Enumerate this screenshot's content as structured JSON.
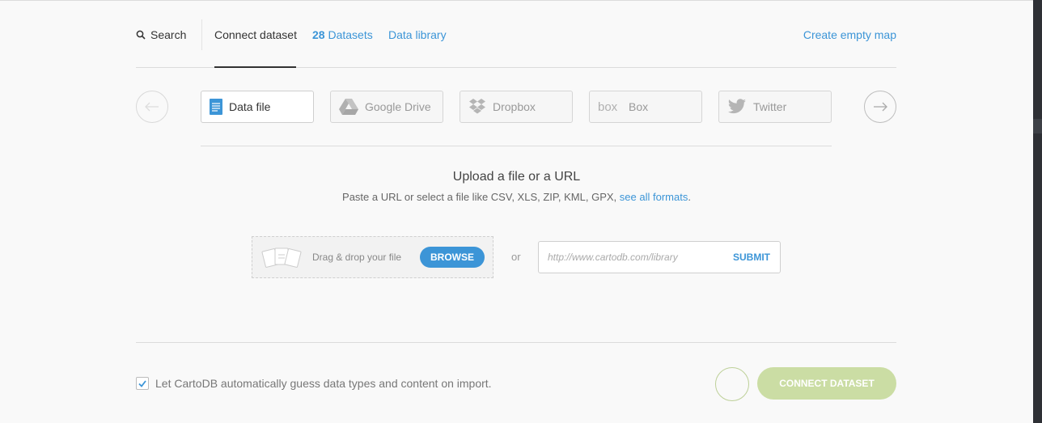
{
  "tabs": {
    "search": "Search",
    "connect": "Connect dataset",
    "datasets_count": "28",
    "datasets_label": "Datasets",
    "library": "Data library",
    "create": "Create empty map"
  },
  "sources": [
    {
      "label": "Data file",
      "icon": "file-icon"
    },
    {
      "label": "Google Drive",
      "icon": "google-drive-icon"
    },
    {
      "label": "Dropbox",
      "icon": "dropbox-icon"
    },
    {
      "label": "Box",
      "icon": "box-icon"
    },
    {
      "label": "Twitter",
      "icon": "twitter-icon"
    }
  ],
  "upload": {
    "title": "Upload a file or a URL",
    "subtitle": "Paste a URL or select a file like CSV, XLS, ZIP, KML, GPX,",
    "formats_link": "see all formats",
    "period": ".",
    "drag_text": "Drag & drop your file",
    "browse": "BROWSE",
    "or": "or",
    "url_placeholder": "http://www.cartodb.com/library",
    "submit": "SUBMIT"
  },
  "footer": {
    "checkbox_label": "Let CartoDB automatically guess data types and content on import.",
    "checked": true,
    "connect_button": "CONNECT DATASET"
  },
  "colors": {
    "accent": "#3c95d7",
    "connect_disabled": "#cbdda4"
  }
}
